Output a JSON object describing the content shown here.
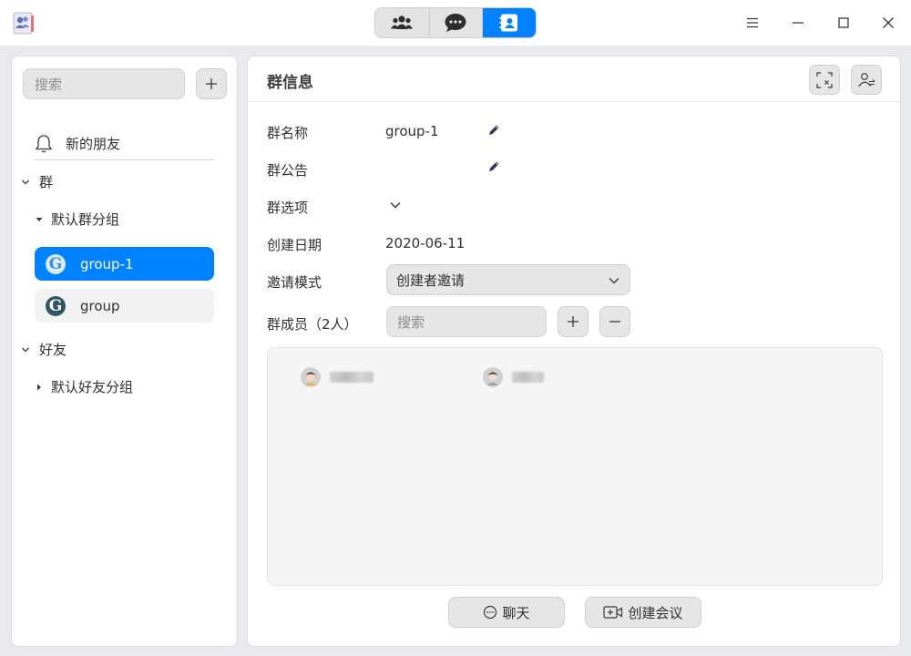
{
  "titlebar": {
    "logo_icon": "contacts-app-icon",
    "tabs": [
      {
        "name": "group-chat-tab",
        "icon": "people-icon",
        "active": false
      },
      {
        "name": "chat-tab",
        "icon": "chat-bubble-icon",
        "active": false
      },
      {
        "name": "contacts-tab",
        "icon": "contact-card-icon",
        "active": true
      }
    ],
    "window_buttons": [
      "menu-icon",
      "minimize-icon",
      "maximize-icon",
      "close-icon"
    ]
  },
  "sidebar": {
    "search_placeholder": "搜索",
    "new_friends_label": "新的朋友",
    "groups_section": "群",
    "default_group_folder": "默认群分组",
    "groups": [
      {
        "label": "group-1",
        "selected": true
      },
      {
        "label": "group",
        "selected": false
      }
    ],
    "friends_section": "好友",
    "default_friend_folder": "默认好友分组"
  },
  "main": {
    "title": "群信息",
    "fields": {
      "name_label": "群名称",
      "name_value": "group-1",
      "notice_label": "群公告",
      "options_label": "群选项",
      "created_label": "创建日期",
      "created_value": "2020-06-11",
      "invite_label": "邀请模式",
      "invite_value": "创建者邀请",
      "members_label": "群成员（2人）"
    },
    "member_search_placeholder": "搜索",
    "members_count": 2,
    "chat_button": "聊天",
    "meeting_button": "创建会议"
  },
  "colors": {
    "accent": "#0081ff",
    "background": "#e9eaee",
    "panel": "#ffffff",
    "button": "#e6e6e6"
  }
}
